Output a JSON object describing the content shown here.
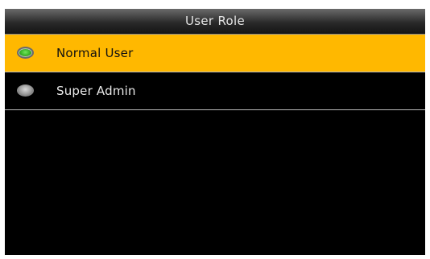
{
  "header": {
    "title": "User Role"
  },
  "options": [
    {
      "label": "Normal User",
      "selected": true,
      "radio_icon": "radio-selected-icon"
    },
    {
      "label": "Super Admin",
      "selected": false,
      "radio_icon": "radio-unselected-icon"
    }
  ],
  "colors": {
    "highlight": "#ffb800",
    "background": "#000000",
    "radio_on": "#3cb52a"
  }
}
